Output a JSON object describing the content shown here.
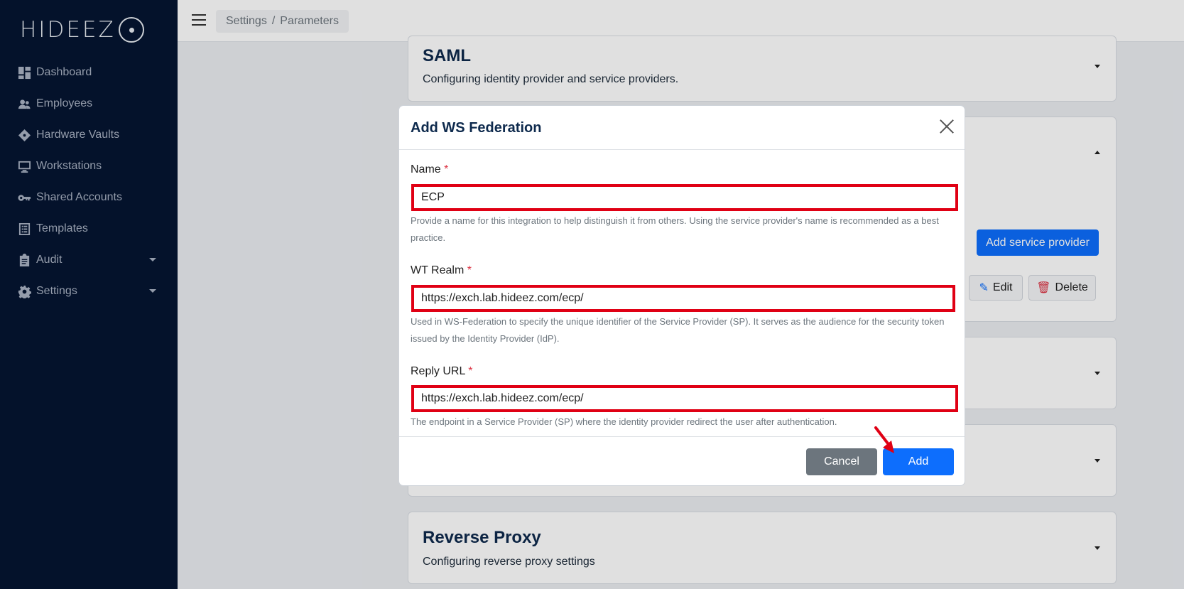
{
  "brand": {
    "logo_text": "HIDEEZ"
  },
  "sidebar": {
    "items": [
      {
        "label": "Dashboard",
        "icon": "dashboard-icon"
      },
      {
        "label": "Employees",
        "icon": "users-icon"
      },
      {
        "label": "Hardware Vaults",
        "icon": "vault-icon"
      },
      {
        "label": "Workstations",
        "icon": "monitor-icon"
      },
      {
        "label": "Shared Accounts",
        "icon": "key-icon"
      },
      {
        "label": "Templates",
        "icon": "list-icon"
      },
      {
        "label": "Audit",
        "icon": "clipboard-icon"
      },
      {
        "label": "Settings",
        "icon": "gear-icon"
      }
    ]
  },
  "topbar": {
    "breadcrumb": {
      "first": "Settings",
      "separator": "/",
      "second": "Parameters"
    }
  },
  "content": {
    "saml": {
      "title": "SAML",
      "subtitle": "Configuring identity provider and service providers."
    },
    "ws_federation": {
      "add_button": "Add service provider",
      "edit_button": "Edit",
      "delete_button": "Delete"
    },
    "reverse_proxy": {
      "title": "Reverse Proxy",
      "subtitle": "Configuring reverse proxy settings"
    }
  },
  "modal": {
    "title": "Add WS Federation",
    "required_mark": "*",
    "name": {
      "label": "Name",
      "value": "ECP",
      "help": "Provide a name for this integration to help distinguish it from others. Using the service provider's name is recommended as a best practice."
    },
    "wt_realm": {
      "label": "WT Realm",
      "value": "https://exch.lab.hideez.com/ecp/",
      "help": "Used in WS-Federation to specify the unique identifier of the Service Provider (SP). It serves as the audience for the security token issued by the Identity Provider (IdP)."
    },
    "reply_url": {
      "label": "Reply URL",
      "value": "https://exch.lab.hideez.com/ecp/",
      "help": "The endpoint in a Service Provider (SP) where the identity provider redirect the user after authentication."
    },
    "cancel_label": "Cancel",
    "add_label": "Add"
  },
  "colors": {
    "sidebar_bg": "#051531",
    "primary": "#0d6efd",
    "highlight": "#e00014",
    "secondary": "#6c757d"
  }
}
